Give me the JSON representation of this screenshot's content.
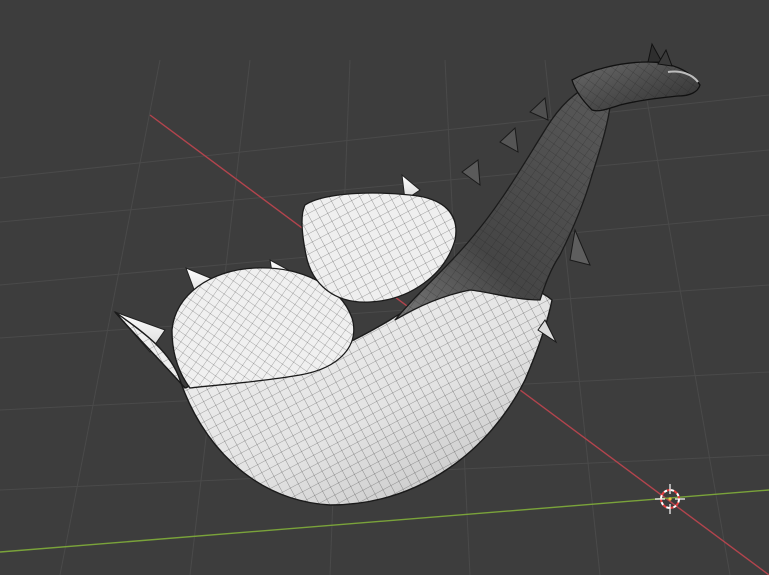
{
  "viewport": {
    "editor": "3D Viewport",
    "shading_mode": "solid",
    "overlay": "wireframe",
    "object": "mesh-model",
    "colors": {
      "background": "#3d3d3d",
      "grid_line": "#4a4a4a",
      "x_axis": "#b2444d",
      "y_axis": "#7aa33a",
      "mesh_light": "#f2f2f2",
      "mesh_dark": "#3a3a3a",
      "wire": "#1e1e1e",
      "cursor_red": "#e84040"
    },
    "icons": {
      "cursor": "3d-cursor-icon"
    }
  }
}
